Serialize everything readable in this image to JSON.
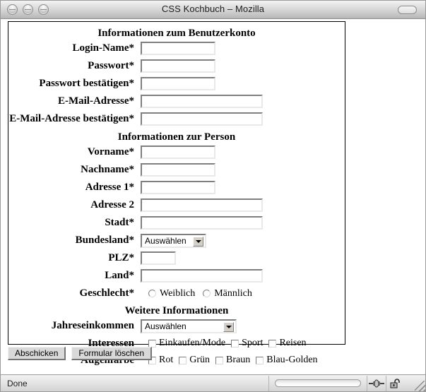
{
  "window": {
    "title": "CSS Kochbuch – Mozilla",
    "traffic_lights": [
      "close-button",
      "minimize-button",
      "zoom-button"
    ],
    "shade_button": "window-shade-button"
  },
  "form": {
    "sections": [
      {
        "legend": "Informationen zum Benutzerkonto",
        "fields": [
          {
            "label": "Login-Name*",
            "type": "text",
            "value": "",
            "width": "short"
          },
          {
            "label": "Passwort*",
            "type": "text",
            "value": "",
            "width": "short"
          },
          {
            "label": "Passwort bestätigen*",
            "type": "text",
            "value": "",
            "width": "short"
          },
          {
            "label": "E-Mail-Adresse*",
            "type": "text",
            "value": "",
            "width": "long"
          },
          {
            "label": "E-Mail-Adresse bestätigen*",
            "type": "text",
            "value": "",
            "width": "long"
          }
        ]
      },
      {
        "legend": "Informationen zur Person",
        "fields": [
          {
            "label": "Vorname*",
            "type": "text",
            "value": "",
            "width": "short"
          },
          {
            "label": "Nachname*",
            "type": "text",
            "value": "",
            "width": "short"
          },
          {
            "label": "Adresse 1*",
            "type": "text",
            "value": "",
            "width": "short"
          },
          {
            "label": "Adresse 2",
            "type": "text",
            "value": "",
            "width": "long"
          },
          {
            "label": "Stadt*",
            "type": "text",
            "value": "",
            "width": "long"
          },
          {
            "label": "Bundesland*",
            "type": "select",
            "value": "Auswählen"
          },
          {
            "label": "PLZ*",
            "type": "text",
            "value": "",
            "width": "plz"
          },
          {
            "label": "Land*",
            "type": "text",
            "value": "",
            "width": "long"
          },
          {
            "label": "Geschlecht*",
            "type": "radio",
            "options": [
              "Weiblich",
              "Männlich"
            ],
            "selected": ""
          }
        ]
      },
      {
        "legend": "Weitere Informationen",
        "fields": [
          {
            "label": "Jahreseinkommen",
            "type": "select",
            "value": "Auswählen"
          },
          {
            "label": "Interessen",
            "type": "checkbox",
            "options": [
              "Einkaufen/Mode",
              "Sport",
              "Reisen"
            ]
          },
          {
            "label": "Augenfarbe",
            "type": "checkbox",
            "options": [
              "Rot",
              "Grün",
              "Braun",
              "Blau-Golden"
            ]
          }
        ]
      }
    ],
    "buttons": {
      "submit": "Abschicken",
      "reset": "Formular löschen"
    }
  },
  "statusbar": {
    "message": "Done",
    "progress_percent": 0,
    "icons": [
      "online-plug-icon",
      "unlocked-padlock-icon",
      "resize-grip"
    ]
  },
  "colors": {
    "window_chrome": "#d6d6d6",
    "form_border": "#000000",
    "field_border_dark": "#7f7f7f",
    "field_border_light": "#e9e9e9",
    "button_face": "#d9d9d9",
    "text": "#000000"
  }
}
